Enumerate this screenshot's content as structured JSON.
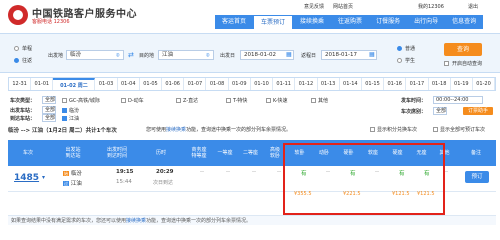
{
  "header": {
    "title": "中国铁路客户服务中心",
    "subtitle": "客服电话 12306",
    "links": [
      "意见反馈",
      "网站首页",
      "我的12306",
      "退出"
    ],
    "nav": [
      "客运首页",
      "车票预订",
      "接续换乘",
      "往返购票",
      "订餐服务",
      "出行向导",
      "信息查询"
    ],
    "active_nav": 1
  },
  "search": {
    "trip_type": [
      "单程",
      "往返"
    ],
    "from_label": "出发地",
    "from_value": "临汾",
    "to_label": "目的地",
    "to_value": "江油",
    "depart_label": "出发日",
    "depart_value": "2018-01-02",
    "return_label": "返程日",
    "return_value": "2018-01-17",
    "passenger_type": [
      "普通",
      "学生"
    ],
    "query_button": "查询",
    "auto_query": "开启自动查询"
  },
  "dates": [
    "12-31",
    "01-01",
    "01-02 周二",
    "01-03",
    "01-04",
    "01-05",
    "01-06",
    "01-07",
    "01-08",
    "01-09",
    "01-10",
    "01-11",
    "01-12",
    "01-13",
    "01-14",
    "01-15",
    "01-16",
    "01-17",
    "01-18",
    "01-19",
    "01-20"
  ],
  "active_date": 2,
  "filters": {
    "train_type_label": "车次类型：",
    "all": "全部",
    "types": [
      "GC-高铁/城际",
      "D-动车",
      "Z-直达",
      "T-特快",
      "K-快速",
      "其他"
    ],
    "depart_station_label": "出发车站：",
    "depart_station_all": "全部",
    "depart_station": "临汾",
    "arrive_station_label": "到达车站：",
    "arrive_station_all": "全部",
    "arrive_station": "江油",
    "depart_time_label": "发车时间：",
    "depart_time_value": "00:00--24:00",
    "seat_type_label": "车次席别：",
    "seat_type_all": "全部",
    "filter_button": "订票助手"
  },
  "info": {
    "route": "临汾 --> 江油（1月2日 周二）共计1个车次",
    "tip_prefix": "您可使用",
    "tip_link": "接续换乘",
    "tip_suffix": "功能，查询途中换乘一次的部分列车余票情况。",
    "show_points": "显示积分兑换车次",
    "show_all": "显示全部可预订车次"
  },
  "table": {
    "headers": [
      "车次",
      "出发站\n到达站",
      "出发时间\n到达时间",
      "历时",
      "商务座\n特等座",
      "一等座",
      "二等座",
      "高级\n软卧",
      "软卧",
      "动卧",
      "硬卧",
      "软座",
      "硬座",
      "无座",
      "其他",
      "备注"
    ],
    "row": {
      "train": "1485",
      "from": "临汾",
      "to": "江油",
      "depart_time": "19:15",
      "arrive_time": "15:44",
      "duration": "20:29",
      "duration_note": "次日到达",
      "business": "--",
      "first": "--",
      "second": "--",
      "adv_soft_sleeper": "--",
      "soft_sleeper": "有",
      "soft_sleeper_price": "¥355.5",
      "moving_sleeper": "--",
      "hard_sleeper": "有",
      "hard_sleeper_price": "¥221.5",
      "soft_seat": "--",
      "hard_seat": "有",
      "hard_seat_price": "¥121.5",
      "no_seat": "有",
      "no_seat_price": "¥121.5",
      "other": "--",
      "book": "预订"
    }
  },
  "footer": {
    "prefix": "如果查询结果中没有满足需求的车次，您还可以使用",
    "link": "接续换乘",
    "suffix": "功能，查询途中换乘一次的部分列车余票情况。"
  }
}
